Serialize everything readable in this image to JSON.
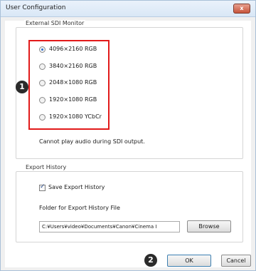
{
  "window": {
    "title": "User Configuration",
    "close_symbol": "x"
  },
  "sdi_monitor": {
    "group_label": "External SDI Monitor",
    "options": [
      {
        "label": "4096×2160 RGB",
        "checked": true
      },
      {
        "label": "3840×2160 RGB",
        "checked": false
      },
      {
        "label": "2048×1080 RGB",
        "checked": false
      },
      {
        "label": "1920×1080 RGB",
        "checked": false
      },
      {
        "label": "1920×1080 YCbCr",
        "checked": false
      }
    ],
    "note": "Cannot play audio during SDI output."
  },
  "export_history": {
    "group_label": "Export History",
    "checkbox_label": "Save Export History",
    "checkbox_checked": true,
    "folder_label": "Folder for Export History File",
    "folder_path": "C:¥Users¥video¥Documents¥Canon¥Cinema I",
    "browse_label": "Browse"
  },
  "footer": {
    "ok_label": "OK",
    "cancel_label": "Cancel"
  },
  "annotations": {
    "badge_1": "1",
    "badge_2": "2"
  },
  "colors": {
    "highlight": "#e21a1a",
    "title_bar": "#dfeaf7",
    "radio_selected": "#2a6fd0",
    "badge": "#2b2b2b"
  }
}
